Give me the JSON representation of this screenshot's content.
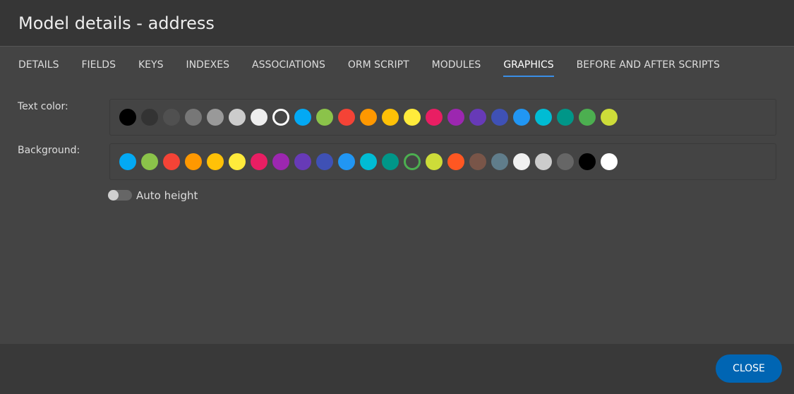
{
  "dialog": {
    "title": "Model details - address"
  },
  "tabs": [
    {
      "label": "DETAILS"
    },
    {
      "label": "FIELDS"
    },
    {
      "label": "KEYS"
    },
    {
      "label": "INDEXES"
    },
    {
      "label": "ASSOCIATIONS"
    },
    {
      "label": "ORM SCRIPT"
    },
    {
      "label": "MODULES"
    },
    {
      "label": "GRAPHICS",
      "active": true
    },
    {
      "label": "BEFORE AND AFTER SCRIPTS"
    }
  ],
  "text_color": {
    "label": "Text color:",
    "selected_index": 7,
    "colors": [
      "#000000",
      "#333333",
      "#505050",
      "#777777",
      "#999999",
      "#cccccc",
      "#eeeeee",
      "#ffffff",
      "#03a9f4",
      "#8bc34a",
      "#f44336",
      "#ff9800",
      "#ffc107",
      "#ffeb3b",
      "#e91e63",
      "#9c27b0",
      "#673ab7",
      "#3f51b5",
      "#2196f3",
      "#00bcd4",
      "#009688",
      "#4caf50",
      "#cddc39"
    ]
  },
  "background": {
    "label": "Background:",
    "selected_index": 13,
    "colors": [
      "#03a9f4",
      "#8bc34a",
      "#f44336",
      "#ff9800",
      "#ffc107",
      "#ffeb3b",
      "#e91e63",
      "#9c27b0",
      "#673ab7",
      "#3f51b5",
      "#2196f3",
      "#00bcd4",
      "#009688",
      "#4caf50",
      "#cddc39",
      "#ff5722",
      "#795548",
      "#607d8b",
      "#f0f0f0",
      "#cccccc",
      "#666666",
      "#000000",
      "#ffffff"
    ]
  },
  "auto_height": {
    "label": "Auto height",
    "on": false
  },
  "footer": {
    "close_label": "CLOSE"
  },
  "accent": "#0065b3"
}
